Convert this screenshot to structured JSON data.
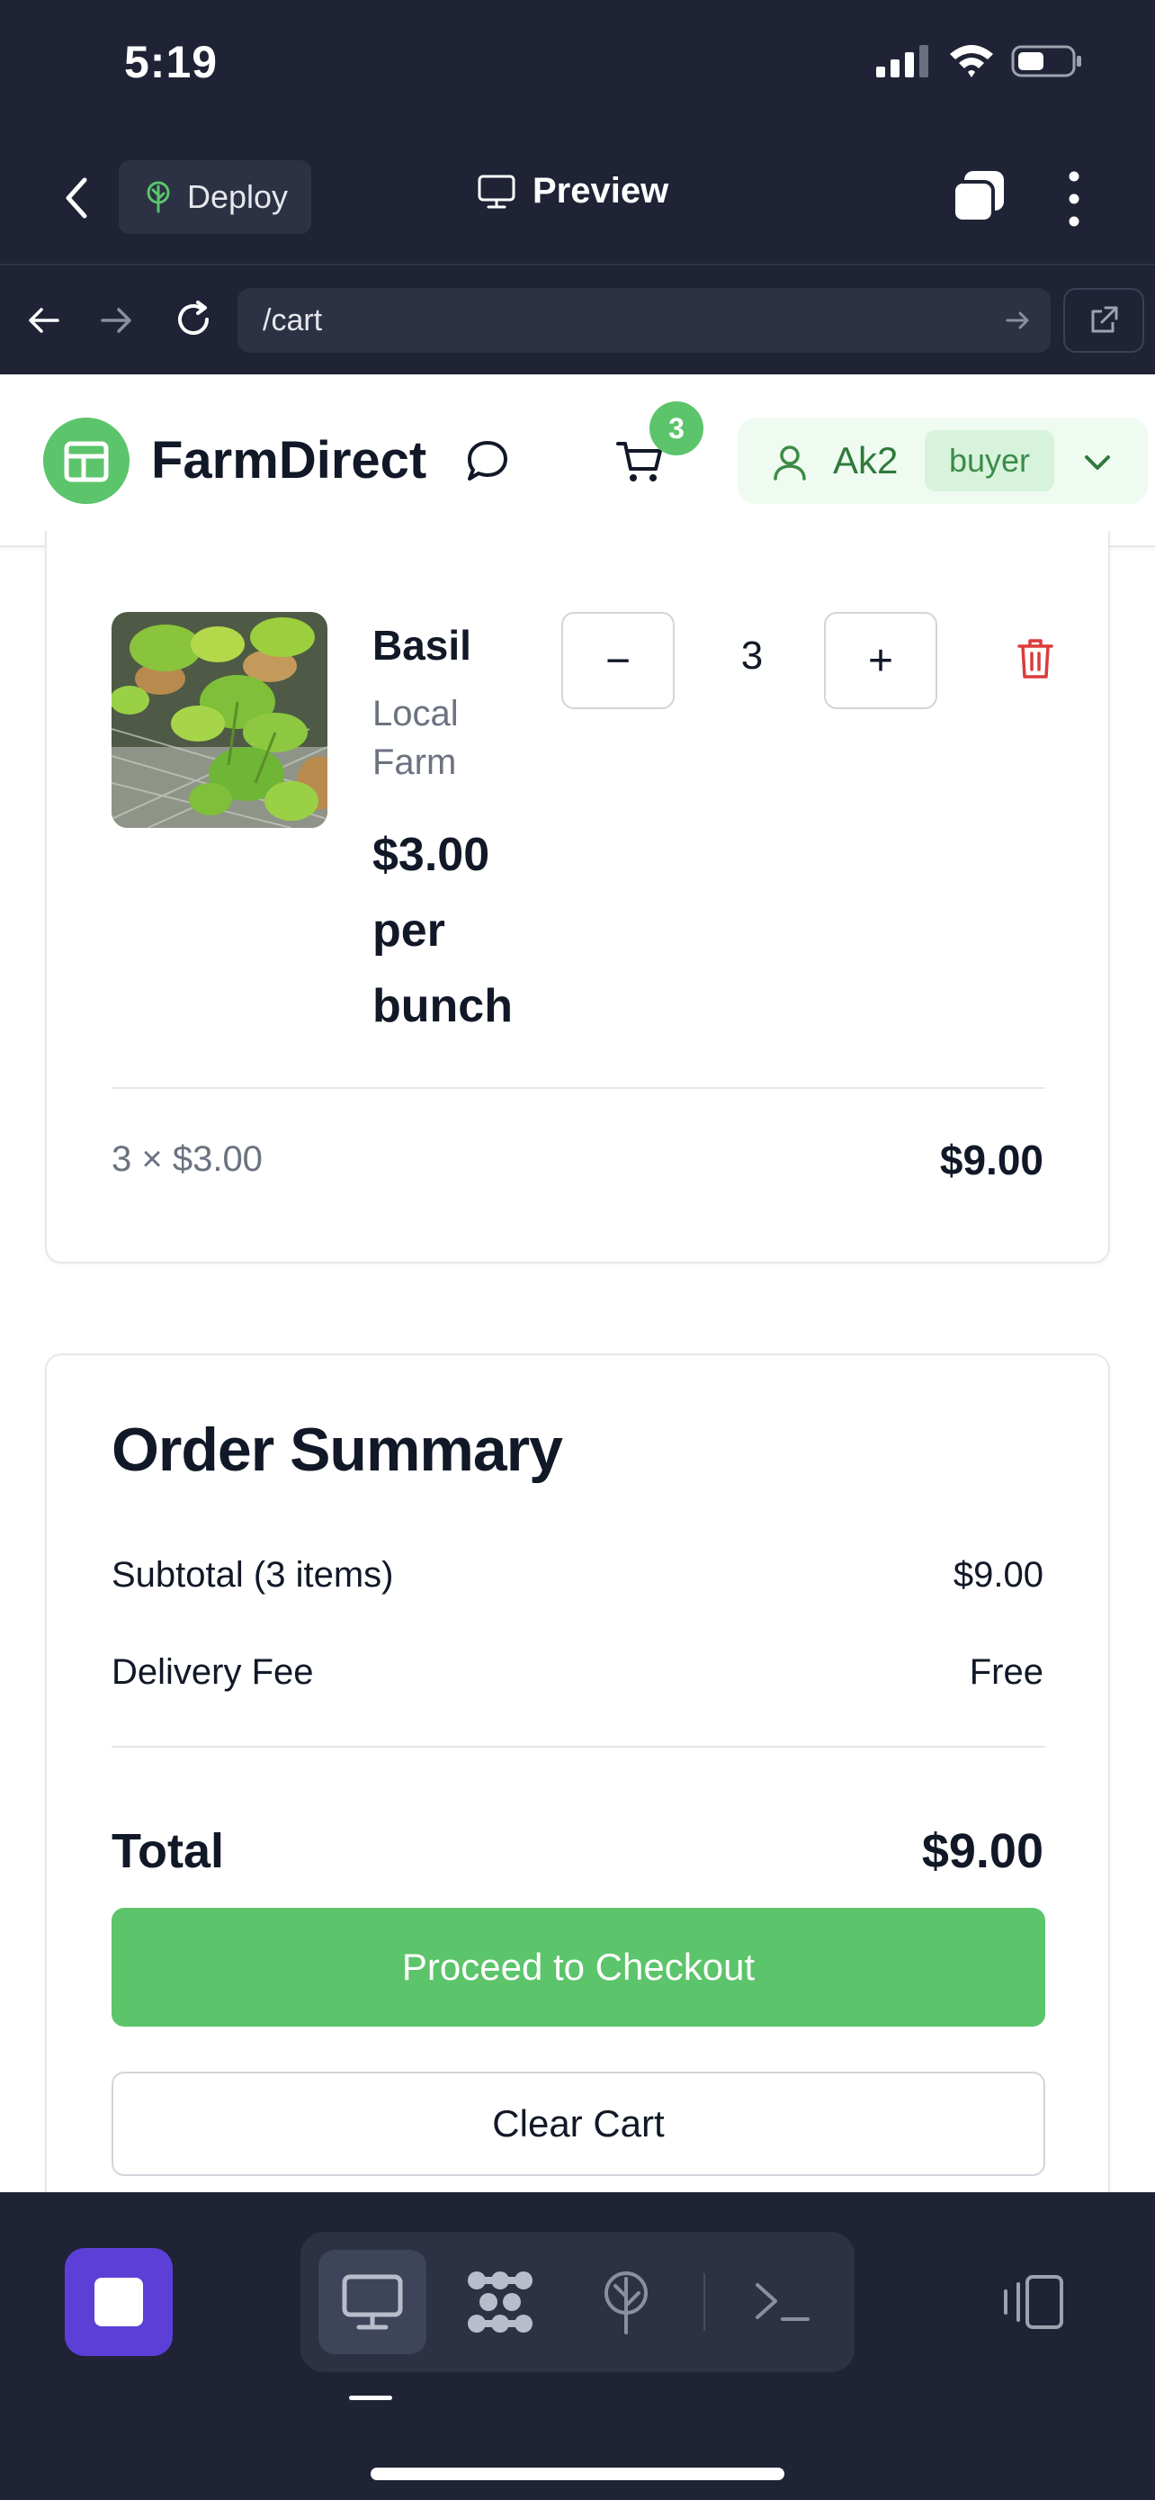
{
  "status_bar": {
    "time": "5:19"
  },
  "browser": {
    "deploy_label": "Deploy",
    "preview_label": "Preview",
    "url": "/cart"
  },
  "header": {
    "brand": "FarmDirect",
    "cart_count": "3",
    "user_name": "Ak2",
    "user_role": "buyer"
  },
  "cart_item": {
    "name": "Basil",
    "farm": "Local Farm",
    "price": "$3.00 per bunch",
    "quantity": "3",
    "calc": "3 × $3.00",
    "line_total": "$9.00",
    "minus_label": "−",
    "plus_label": "+"
  },
  "summary": {
    "title": "Order Summary",
    "subtotal_label": "Subtotal (3 items)",
    "subtotal_value": "$9.00",
    "delivery_label": "Delivery Fee",
    "delivery_value": "Free",
    "total_label": "Total",
    "total_value": "$9.00",
    "checkout_label": "Proceed to Checkout",
    "clear_label": "Clear Cart"
  },
  "colors": {
    "brand_green": "#5cc46a",
    "chrome_dark": "#1f2335",
    "danger_red": "#dc3b3b",
    "stop_purple": "#5b3fd6"
  },
  "icons": {
    "status": [
      "signal-icon",
      "wifi-icon",
      "battery-icon"
    ],
    "browser": [
      "chevron-left-icon",
      "tree-icon",
      "monitor-icon",
      "tabs-icon",
      "more-icon",
      "arrow-left-icon",
      "arrow-right-icon",
      "reload-icon",
      "external-link-icon"
    ],
    "app": [
      "logo-icon",
      "chat-icon",
      "cart-icon",
      "user-icon",
      "chevron-down-icon",
      "trash-icon"
    ],
    "toolbar": [
      "stop-icon",
      "monitor-icon",
      "apps-icon",
      "deploy-icon",
      "terminal-icon",
      "split-view-icon"
    ]
  }
}
